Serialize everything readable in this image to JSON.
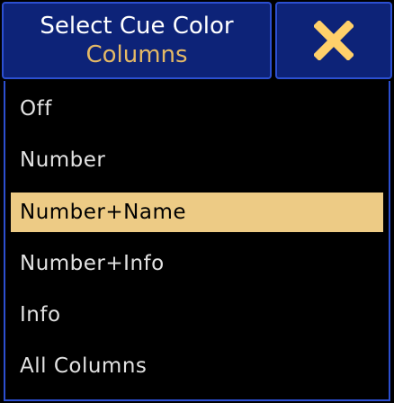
{
  "dialog": {
    "title_line_1": "Select Cue Color",
    "title_line_2": "Columns",
    "close_icon": "close-icon"
  },
  "options": [
    {
      "label": "Off",
      "selected": false
    },
    {
      "label": "Number",
      "selected": false
    },
    {
      "label": "Number+Name",
      "selected": true
    },
    {
      "label": "Number+Info",
      "selected": false
    },
    {
      "label": "Info",
      "selected": false
    },
    {
      "label": "All Columns",
      "selected": false
    }
  ],
  "colors": {
    "header_bg": "#0d2378",
    "header_border": "#2c4fd0",
    "title_white": "#ffffff",
    "title_gold": "#e4b966",
    "selected_bg": "#edcb85",
    "close_x": "#ffd06a"
  }
}
